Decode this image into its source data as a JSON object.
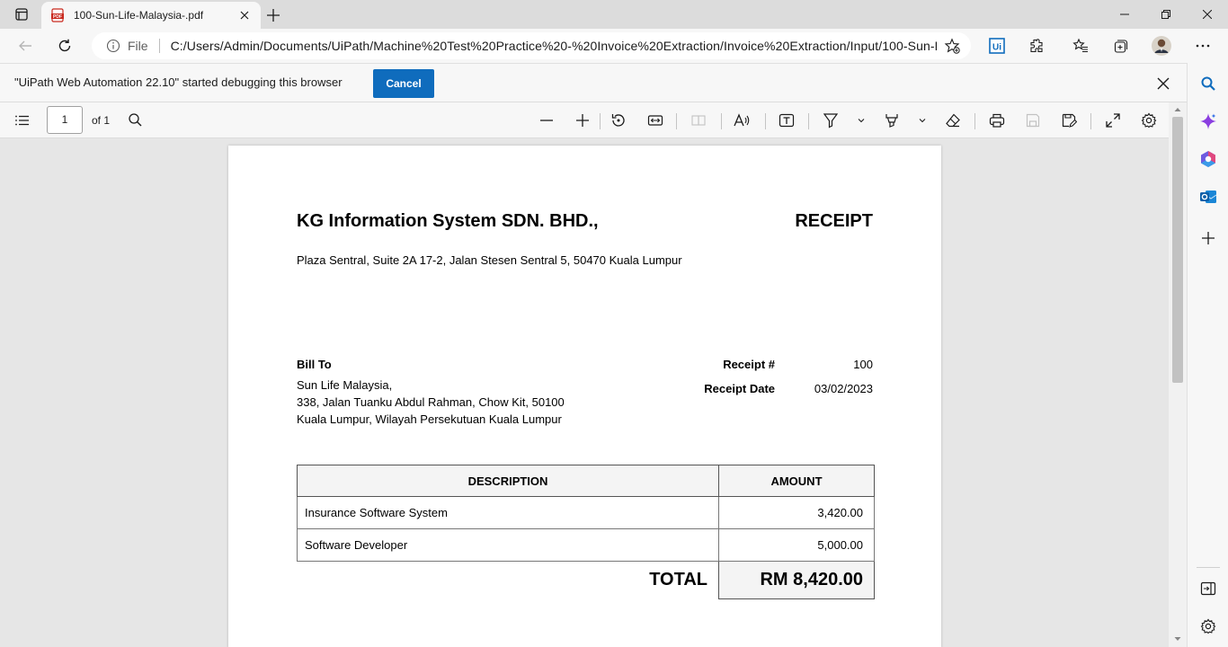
{
  "browser": {
    "tab": {
      "title": "100-Sun-Life-Malaysia-.pdf"
    },
    "address": {
      "scheme_label": "File",
      "url": "C:/Users/Admin/Documents/UiPath/Machine%20Test%20Practice%20-%20Invoice%20Extraction/Invoice%20Extraction/Input/100-Sun-Li..."
    }
  },
  "debug_bar": {
    "message": "\"UiPath Web Automation 22.10\" started debugging this browser",
    "cancel_label": "Cancel"
  },
  "pdf_toolbar": {
    "page_number": "1",
    "page_count_label": "of 1"
  },
  "receipt": {
    "company": "KG Information System SDN. BHD.,",
    "doc_title": "RECEIPT",
    "company_address": "Plaza Sentral, Suite 2A 17-2, Jalan Stesen Sentral 5, 50470 Kuala Lumpur",
    "bill_to": {
      "label": "Bill To",
      "lines": [
        "Sun Life Malaysia,",
        "338, Jalan Tuanku Abdul Rahman, Chow Kit, 50100",
        "Kuala Lumpur, Wilayah Persekutuan Kuala Lumpur"
      ]
    },
    "receipt_no_label": "Receipt #",
    "receipt_no": "100",
    "receipt_date_label": "Receipt Date",
    "receipt_date": "03/02/2023",
    "table": {
      "headers": [
        "DESCRIPTION",
        "AMOUNT"
      ],
      "rows": [
        {
          "description": "Insurance Software System",
          "amount": "3,420.00"
        },
        {
          "description": "Software Developer",
          "amount": "5,000.00"
        }
      ],
      "total_label": "TOTAL",
      "total_value": "RM 8,420.00"
    }
  },
  "colors": {
    "accent": "#0f6cbd",
    "pdf_favicon": "#c8281d"
  }
}
